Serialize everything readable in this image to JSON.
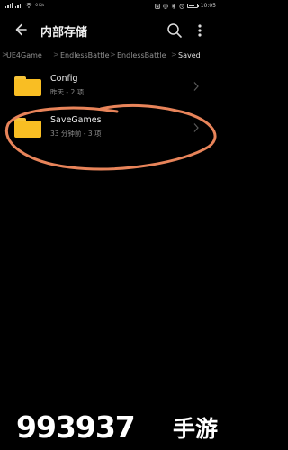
{
  "status_bar": {
    "network_speed": "0 K/s",
    "time": "10:05"
  },
  "header": {
    "title": "内部存储",
    "back_icon": "back-arrow-icon",
    "search_icon": "search-icon",
    "more_icon": "more-vert-icon"
  },
  "breadcrumb": {
    "items": [
      "UE4Game",
      "EndlessBattle",
      "EndlessBattle",
      "Saved"
    ],
    "separator": ">"
  },
  "files": [
    {
      "name": "Config",
      "meta": "昨天 - 2 项",
      "icon": "folder-icon"
    },
    {
      "name": "SaveGames",
      "meta": "33 分钟前 - 3 项",
      "icon": "folder-icon"
    }
  ],
  "colors": {
    "background": "#000000",
    "folder": "#f9be23",
    "annotation": "#e8845a"
  },
  "watermark": {
    "number": "993937",
    "text": "手游"
  }
}
